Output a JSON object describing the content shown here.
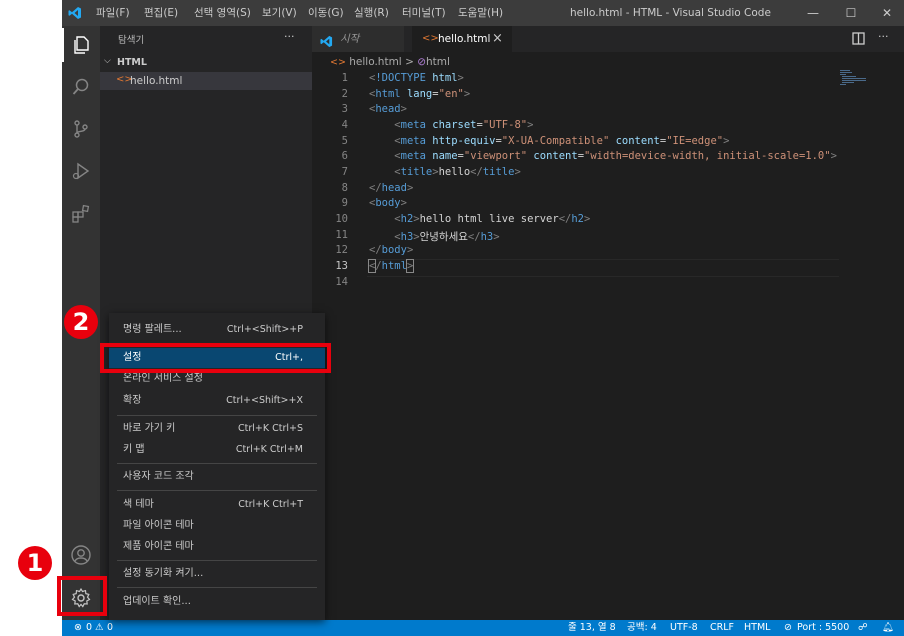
{
  "titlebar": {
    "menus": [
      "파일(F)",
      "편집(E)",
      "선택 영역(S)",
      "보기(V)",
      "이동(G)",
      "실행(R)",
      "터미널(T)",
      "도움말(H)"
    ],
    "title": "hello.html - HTML - Visual Studio Code",
    "minimize": "—",
    "maximize": "☐",
    "close": "✕"
  },
  "sidebar": {
    "header": "탐색기",
    "more": "···",
    "folder": "HTML",
    "file": "hello.html"
  },
  "tabs": [
    {
      "label": "시작",
      "active": false
    },
    {
      "label": "hello.html",
      "active": true
    }
  ],
  "tab_close": "×",
  "breadcrumb": {
    "file": "hello.html",
    "sep": ">",
    "node": "html"
  },
  "code": {
    "line_numbers": [
      "1",
      "2",
      "3",
      "4",
      "5",
      "6",
      "7",
      "8",
      "9",
      "10",
      "11",
      "12",
      "13",
      "14"
    ],
    "current_line": "13"
  },
  "menu": {
    "items": [
      {
        "label": "명령 팔레트...",
        "key": "Ctrl+<Shift>+P"
      },
      {
        "label": "설정",
        "key": "Ctrl+,"
      },
      {
        "label": "온라인 서비스 설정",
        "key": ""
      },
      {
        "label": "확장",
        "key": "Ctrl+<Shift>+X"
      },
      {
        "label": "바로 가기 키",
        "key": "Ctrl+K Ctrl+S"
      },
      {
        "label": "키 맵",
        "key": "Ctrl+K Ctrl+M"
      },
      {
        "label": "사용자 코드 조각",
        "key": ""
      },
      {
        "label": "색 테마",
        "key": "Ctrl+K Ctrl+T"
      },
      {
        "label": "파일 아이콘 테마",
        "key": ""
      },
      {
        "label": "제품 아이콘 테마",
        "key": ""
      },
      {
        "label": "설정 동기화 켜기...",
        "key": ""
      },
      {
        "label": "업데이트 확인...",
        "key": ""
      }
    ]
  },
  "statusbar": {
    "errors": "0",
    "warnings": "0",
    "position": "줄 13, 열 8",
    "spaces": "공백: 4",
    "encoding": "UTF-8",
    "eol": "CRLF",
    "language": "HTML",
    "port": "Port : 5500"
  },
  "badges": {
    "one": "1",
    "two": "2"
  },
  "colors": {
    "accent": "#007acc",
    "highlight": "#e8000d",
    "selected_item": "#094771"
  }
}
